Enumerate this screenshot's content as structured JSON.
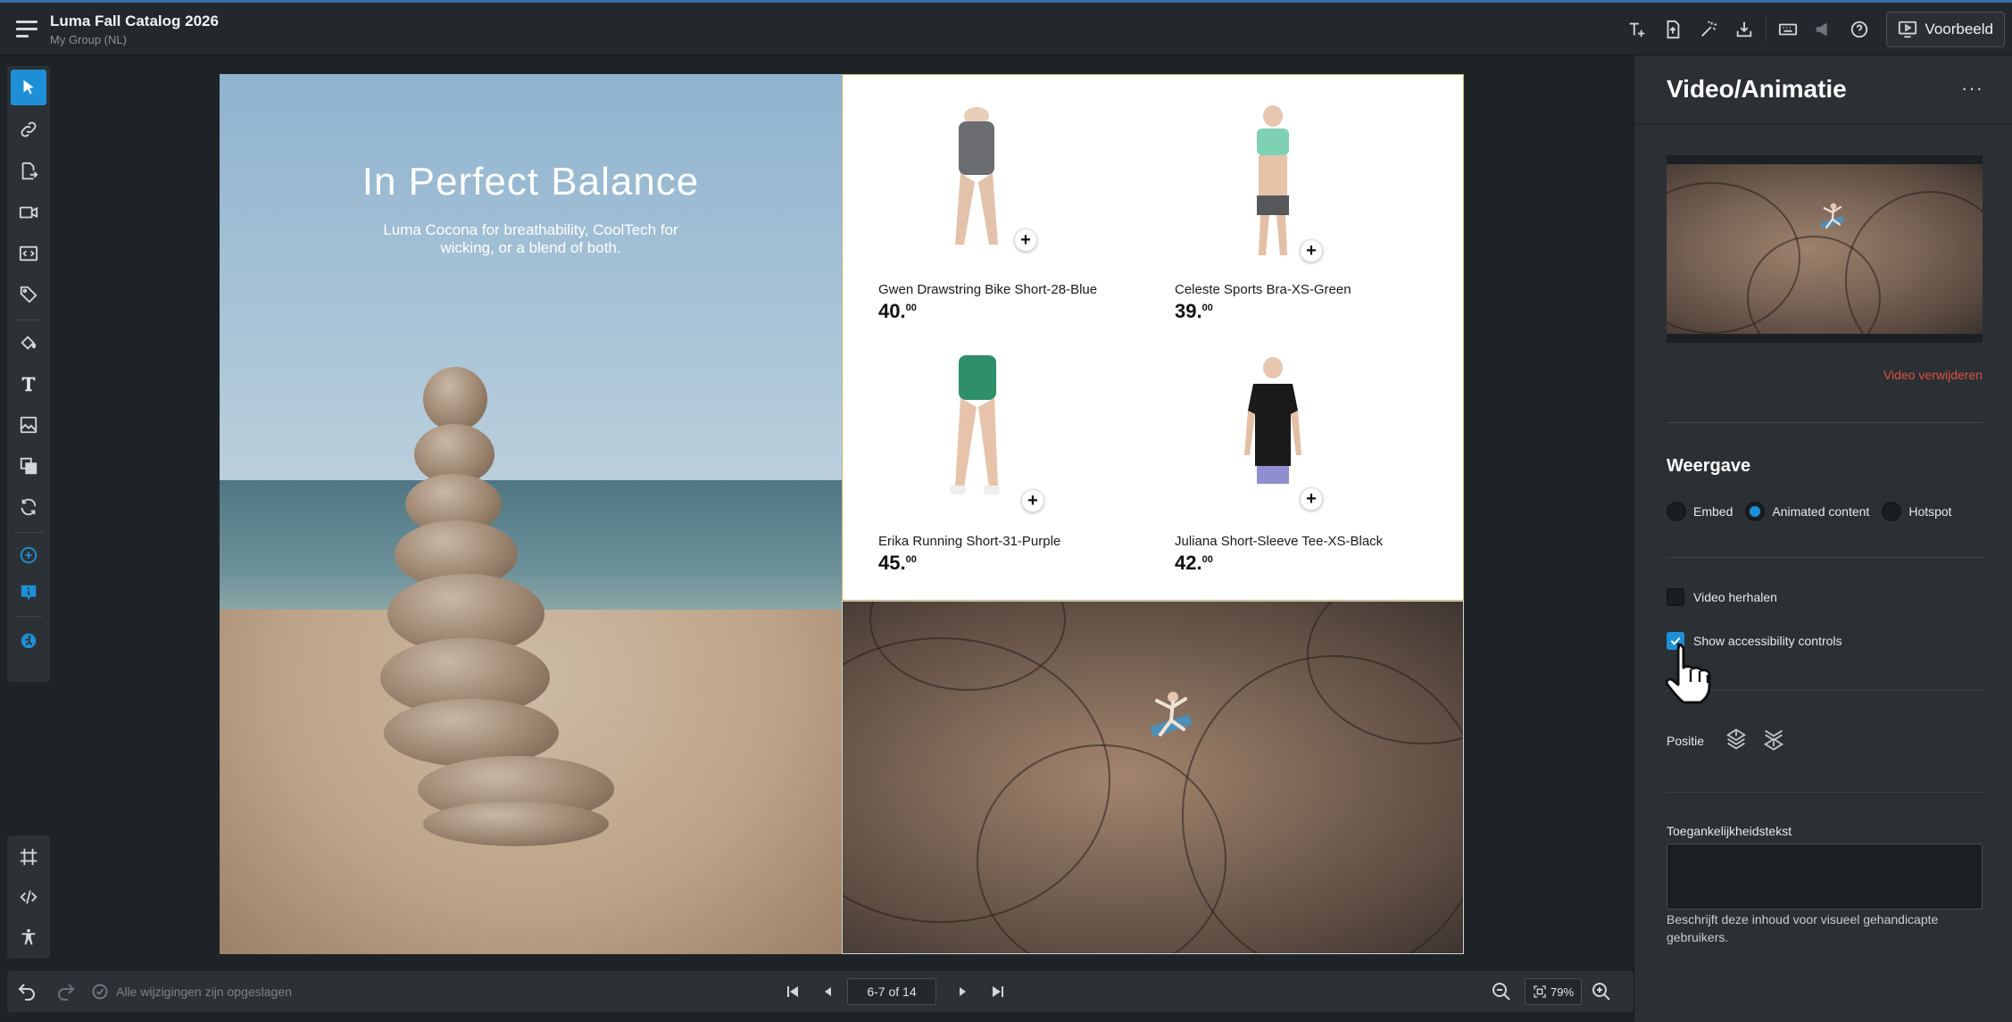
{
  "app": {
    "document_title": "Luma Fall Catalog 2026",
    "group": "My Group (NL)",
    "preview_label": "Voorbeeld"
  },
  "top_tools": [
    "add-text-icon",
    "export-page-icon",
    "magic-wand-icon",
    "download-icon",
    "keyboard-icon",
    "announcement-icon",
    "help-icon"
  ],
  "left_tools": [
    "select-arrow-icon",
    "link-icon",
    "page-link-icon",
    "video-icon",
    "embed-code-icon",
    "tag-icon",
    "fill-icon",
    "text-icon",
    "image-icon",
    "layers-icon",
    "sync-icon",
    "add-circle-icon",
    "info-icon",
    "accessibility-plugin-icon"
  ],
  "left_bottom_tools": [
    "crop-frame-icon",
    "code-icon",
    "accessibility-icon"
  ],
  "page_left": {
    "headline": "In Perfect Balance",
    "subtitle": "Luma Cocona for breathability, CoolTech for wicking, or a blend of both."
  },
  "products": [
    {
      "name": "Gwen Drawstring Bike Short-28-Blue",
      "price_main": "40.",
      "price_cents": "00",
      "color": "#6a6c70"
    },
    {
      "name": "Celeste Sports Bra-XS-Green",
      "price_main": "39.",
      "price_cents": "00",
      "color": "#7fd1b4"
    },
    {
      "name": "Erika Running Short-31-Purple",
      "price_main": "45.",
      "price_cents": "00",
      "color": "#2e8f6a"
    },
    {
      "name": "Juliana Short-Sleeve Tee-XS-Black",
      "price_main": "42.",
      "price_cents": "00",
      "color": "#1a1a1a"
    }
  ],
  "bottom_bar": {
    "saved_status": "Alle wijzigingen zijn opgeslagen",
    "page_indicator": "6-7 of 14",
    "zoom": "79%"
  },
  "panel": {
    "title": "Video/Animatie",
    "more": "···",
    "remove_video": "Video verwijderen",
    "display_title": "Weergave",
    "display_options": [
      {
        "label": "Embed",
        "selected": false
      },
      {
        "label": "Animated content",
        "selected": true
      },
      {
        "label": "Hotspot",
        "selected": false
      }
    ],
    "loop_label": "Video herhalen",
    "loop_checked": false,
    "a11y_label": "Show accessibility controls",
    "a11y_checked": true,
    "position_label": "Positie",
    "alt_label": "Toegankelijkheidstekst",
    "alt_value": "",
    "alt_help": "Beschrijft deze inhoud voor visueel gehandicapte gebruikers."
  },
  "colors": {
    "accent": "#1e8fd6",
    "danger": "#e0523f",
    "panel_bg": "#2b3035",
    "canvas_bg": "#1e2328"
  }
}
